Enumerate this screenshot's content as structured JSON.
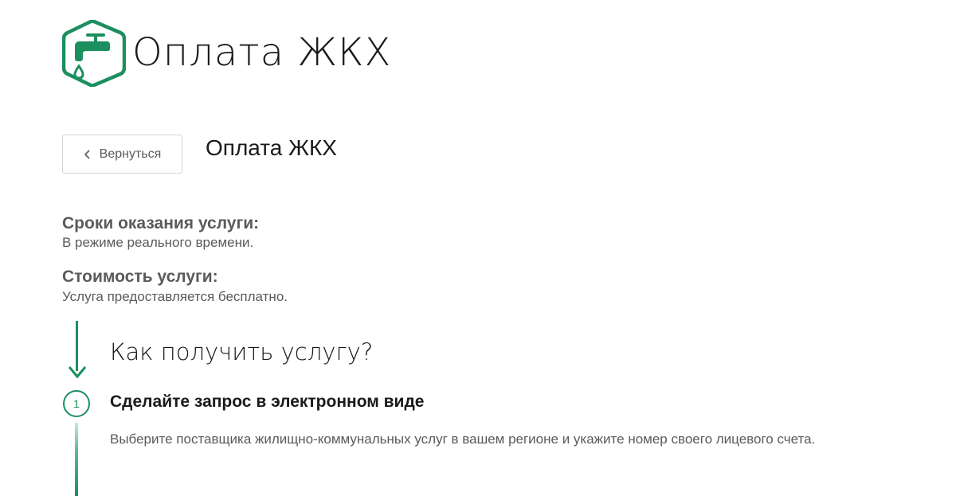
{
  "header": {
    "logo_icon": "water-tap-icon",
    "service_title": "Оплата ЖКХ"
  },
  "nav": {
    "back_label": "Вернуться",
    "back_icon": "chevron-left-icon"
  },
  "page": {
    "title": "Оплата ЖКХ"
  },
  "info": {
    "terms_heading": "Сроки оказания услуги:",
    "terms_text": "В режиме реального времени.",
    "cost_heading": "Стоимость услуги:",
    "cost_text": "Услуга предоставляется бесплатно."
  },
  "howto": {
    "title": "Как получить услугу?",
    "steps": [
      {
        "number": "1",
        "title": "Сделайте запрос в электронном виде",
        "description": "Выберите поставщика жилищно-коммунальных услуг в вашем регионе и укажите номер своего лицевого счета."
      }
    ]
  },
  "colors": {
    "accent": "#1c8f5f",
    "text_muted": "#5a5a5a",
    "text_dark": "#1a1a1a",
    "border": "#d3d3d3"
  }
}
